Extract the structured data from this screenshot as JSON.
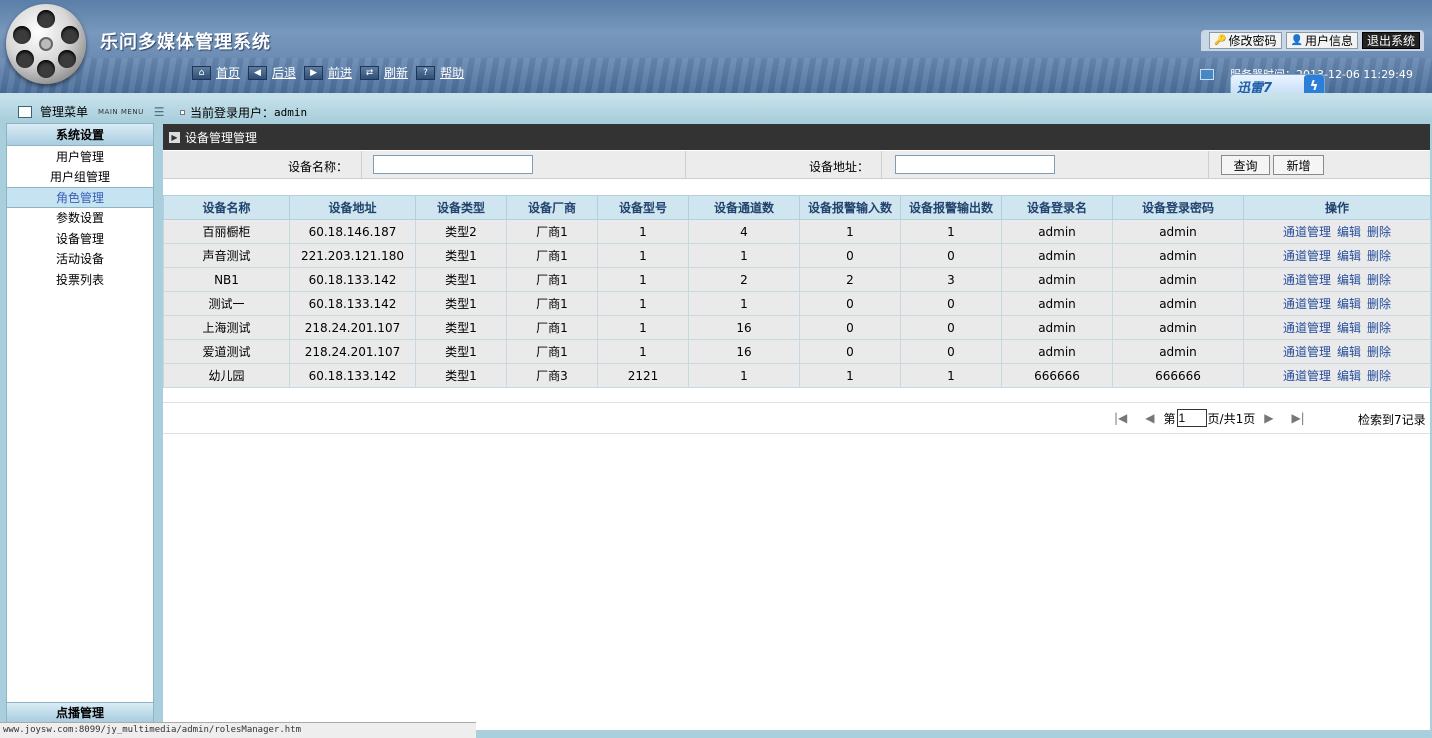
{
  "header": {
    "app_title": "乐问多媒体管理系统",
    "top_buttons": {
      "change_password": "修改密码",
      "user_info": "用户信息",
      "logout": "退出系统"
    },
    "nav": {
      "home": "首页",
      "back": "后退",
      "forward": "前进",
      "refresh": "刷新",
      "help": "帮助"
    },
    "server_time": "服务器时间：2013-12-06 11:29:49",
    "xunlei_badge": "迅雷7"
  },
  "menu": {
    "title": "管理菜单",
    "title_en": "MAIN MENU",
    "login_user_label": "当前登录用户：",
    "login_user": "admin"
  },
  "sidebar": {
    "section": "系统设置",
    "items": [
      "用户管理",
      "用户组管理",
      "角色管理",
      "参数设置",
      "设备管理",
      "活动设备",
      "投票列表"
    ],
    "active_index": 2,
    "footer": "点播管理"
  },
  "main": {
    "title": "设备管理管理",
    "search": {
      "name_label": "设备名称：",
      "name_value": "",
      "address_label": "设备地址：",
      "address_value": "",
      "query_button": "查询",
      "add_button": "新增"
    },
    "table": {
      "columns": [
        "设备名称",
        "设备地址",
        "设备类型",
        "设备厂商",
        "设备型号",
        "设备通道数",
        "设备报警输入数",
        "设备报警输出数",
        "设备登录名",
        "设备登录密码",
        "操作"
      ],
      "rows": [
        [
          "百丽橱柜",
          "60.18.146.187",
          "类型2",
          "厂商1",
          "1",
          "4",
          "1",
          "1",
          "admin",
          "admin"
        ],
        [
          "声音测试",
          "221.203.121.180",
          "类型1",
          "厂商1",
          "1",
          "1",
          "0",
          "0",
          "admin",
          "admin"
        ],
        [
          "NB1",
          "60.18.133.142",
          "类型1",
          "厂商1",
          "1",
          "2",
          "2",
          "3",
          "admin",
          "admin"
        ],
        [
          "测试一",
          "60.18.133.142",
          "类型1",
          "厂商1",
          "1",
          "1",
          "0",
          "0",
          "admin",
          "admin"
        ],
        [
          "上海测试",
          "218.24.201.107",
          "类型1",
          "厂商1",
          "1",
          "16",
          "0",
          "0",
          "admin",
          "admin"
        ],
        [
          "爱道测试",
          "218.24.201.107",
          "类型1",
          "厂商1",
          "1",
          "16",
          "0",
          "0",
          "admin",
          "admin"
        ],
        [
          "幼儿园",
          "60.18.133.142",
          "类型1",
          "厂商3",
          "2121",
          "1",
          "1",
          "1",
          "666666",
          "666666"
        ]
      ],
      "actions": [
        "通道管理",
        "编辑",
        "删除"
      ]
    },
    "pager": {
      "prefix": "第",
      "page_value": "1",
      "suffix": "页/共1页",
      "records": "检索到7记录"
    }
  },
  "status_bar": "www.joysw.com:8099/jy_multimedia/admin/rolesManager.htm"
}
